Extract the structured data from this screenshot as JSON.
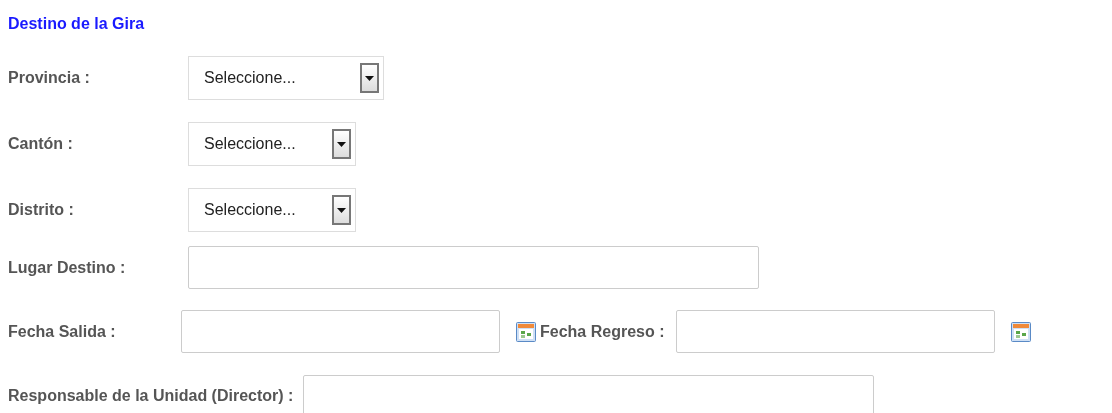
{
  "section_title": "Destino de la Gira",
  "rows": [
    {
      "fields": [
        {
          "kind": "select",
          "label": "Provincia :",
          "value": "Seleccione..."
        }
      ]
    },
    {
      "fields": [
        {
          "kind": "select",
          "label": "Cantón :",
          "value": "Seleccione..."
        }
      ]
    },
    {
      "fields": [
        {
          "kind": "select",
          "label": "Distrito :",
          "value": "Seleccione..."
        }
      ]
    },
    {
      "fields": [
        {
          "kind": "text",
          "label": "Lugar Destino :"
        }
      ]
    },
    {
      "fields": [
        {
          "kind": "date",
          "label": "Fecha Salida :"
        },
        {
          "kind": "date",
          "label": "Fecha Regreso :"
        }
      ]
    },
    {
      "fields": [
        {
          "kind": "text",
          "label": "Responsable de la Unidad (Director) :"
        }
      ]
    }
  ]
}
